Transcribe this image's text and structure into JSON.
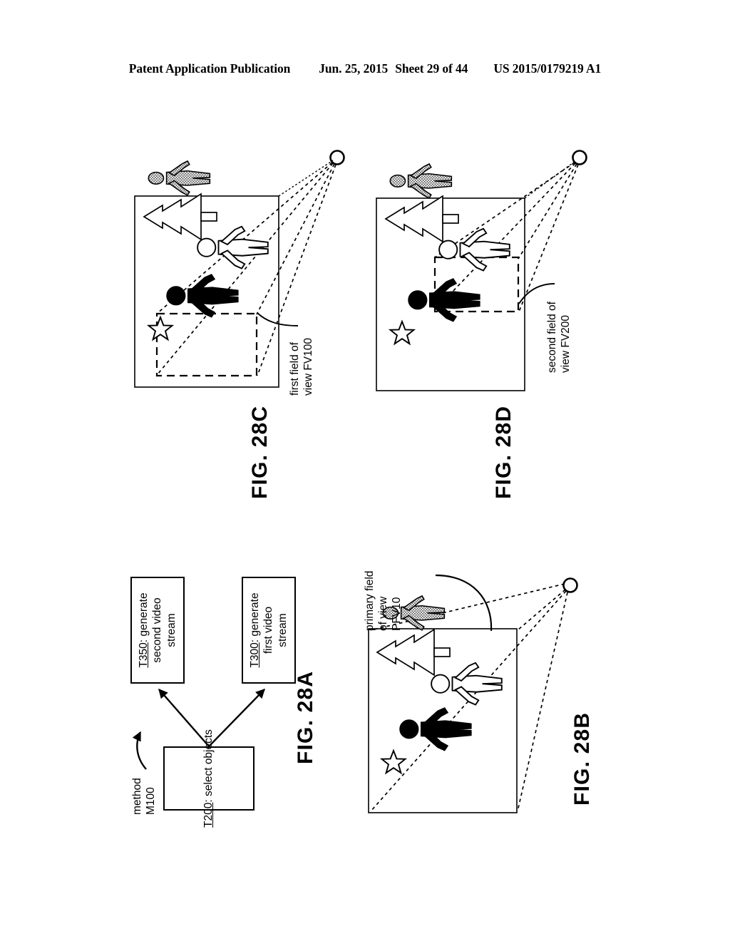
{
  "header": {
    "publication": "Patent Application Publication",
    "date": "Jun. 25, 2015",
    "sheet": "Sheet 29 of 44",
    "number": "US 2015/0179219 A1"
  },
  "figures": {
    "fig28a": {
      "label": "FIG. 28A",
      "annotation_line1": "method",
      "annotation_line2": "M100",
      "boxes": [
        {
          "id": "T200",
          "ref": "T200",
          "line1": "T200: select objects",
          "full_text": "T200: select objects"
        },
        {
          "id": "T300",
          "ref": "T300",
          "line1": "T300: generate",
          "line2": "first video",
          "line3": "stream",
          "full_text": "T300: generate first video stream"
        },
        {
          "id": "T350",
          "ref": "T350",
          "line1": "T350: generate",
          "line2": "second video",
          "line3": "stream",
          "full_text": "T350: generate second video stream"
        }
      ]
    },
    "fig28b": {
      "label": "FIG. 28B",
      "callout_line1": "primary field",
      "callout_line2": "of view",
      "callout_line3": "PFV10",
      "callout_full": "primary field of view PFV10"
    },
    "fig28c": {
      "label": "FIG. 28C",
      "callout_line1": "first field of",
      "callout_line2": "view FV100",
      "callout_full": "first field of view FV100"
    },
    "fig28d": {
      "label": "FIG. 28D",
      "callout_line1": "second field of",
      "callout_line2": "view FV200",
      "callout_full": "second field of view FV200"
    }
  },
  "colors": {
    "ink": "#000000",
    "paper": "#ffffff",
    "hatch_fill": "#b8b8b8"
  }
}
